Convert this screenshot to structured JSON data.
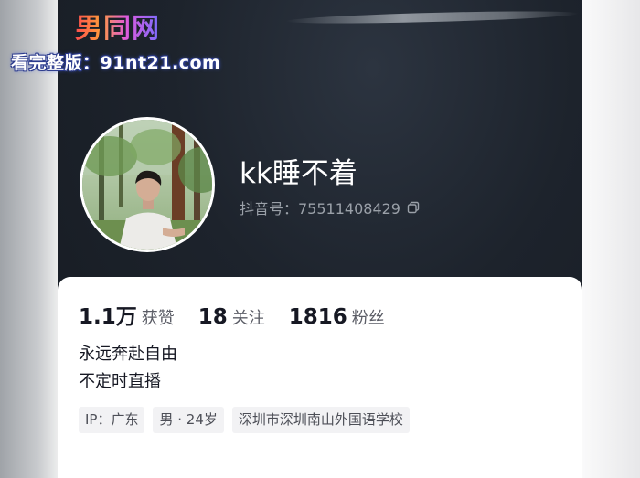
{
  "watermark": {
    "logo_text": "男同网",
    "url_text": "看完整版：91nt21.com"
  },
  "profile": {
    "nickname": "kk睡不着",
    "douyin_id": "抖音号：75511408429",
    "copy_icon": "copy-icon",
    "avatar_icon": "avatar-photo"
  },
  "stats": [
    {
      "value": "1.1万",
      "label": "获赞"
    },
    {
      "value": "18",
      "label": "关注"
    },
    {
      "value": "1816",
      "label": "粉丝"
    }
  ],
  "bio": {
    "line1": "永远奔赴自由",
    "line2": "不定时直播"
  },
  "tags": [
    {
      "text": "IP：广东"
    },
    {
      "text": "男 · 24岁"
    },
    {
      "text": "深圳市深圳南山外国语学校"
    }
  ],
  "colors": {
    "header_bg": "#1d232c",
    "card_bg": "#ffffff",
    "text_primary": "#161823",
    "text_secondary": "#5b5d66",
    "tag_bg": "#f2f2f4"
  }
}
